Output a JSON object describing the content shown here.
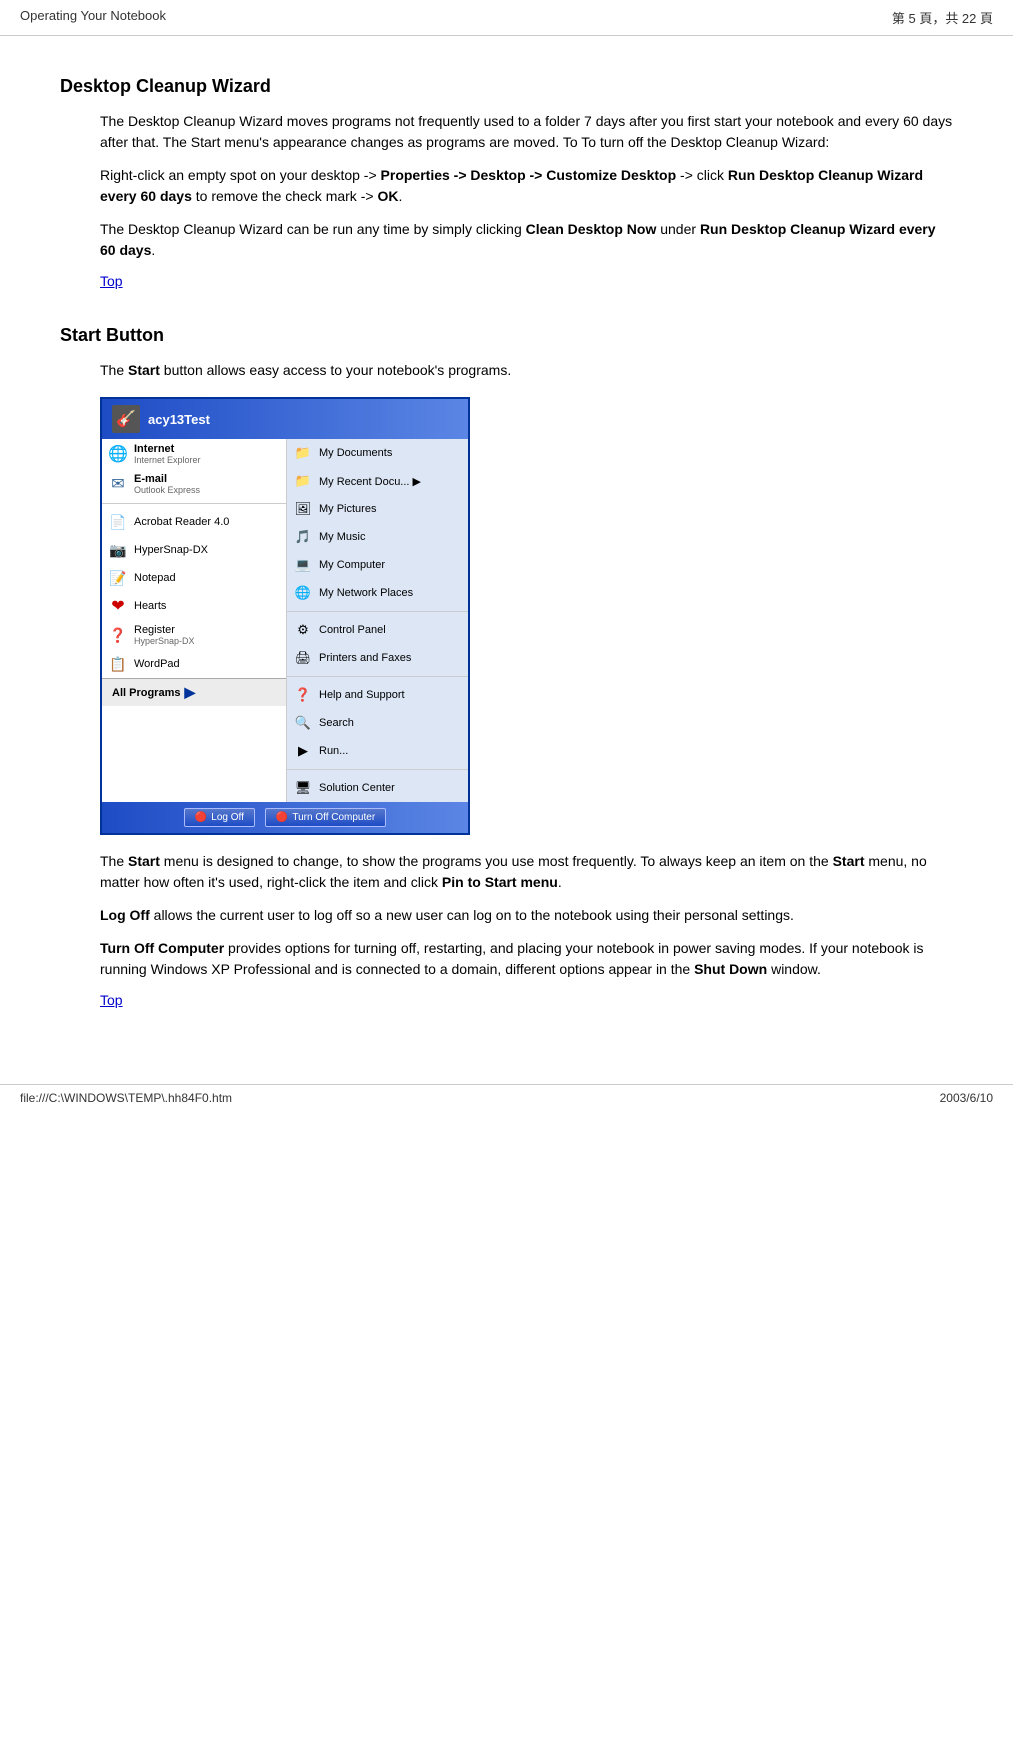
{
  "header": {
    "title": "Operating Your Notebook",
    "page_info": "第 5 頁，共 22 頁"
  },
  "footer": {
    "file_path": "file:///C:\\WINDOWS\\TEMP\\.hh84F0.htm",
    "date": "2003/6/10"
  },
  "section1": {
    "title": "Desktop Cleanup Wizard",
    "paragraphs": [
      "The Desktop Cleanup Wizard moves programs not frequently used to a folder 7 days after you first start your notebook and every 60 days after that. The Start menu's appearance changes as programs are moved. To To turn off the Desktop Cleanup Wizard:",
      "Right-click an empty spot on your desktop -> Properties -> Desktop -> Customize Desktop -> click Run Desktop Cleanup Wizard every 60 days to remove the check mark -> OK.",
      "The Desktop Cleanup Wizard can be run any time by simply clicking Clean Desktop Now under Run Desktop Cleanup Wizard every 60 days."
    ],
    "bold_parts": {
      "p2_b1": "Properties -&gt; Desktop -&gt;",
      "p2_b2": "Customize Desktop",
      "p2_b3": "Run Desktop Cleanup Wizard every 60 days",
      "p2_b4": "OK",
      "p3_b1": "Clean Desktop Now",
      "p3_b2": "Run Desktop Cleanup Wizard every 60 days"
    },
    "top_link": "Top"
  },
  "section2": {
    "title": "Start Button",
    "intro": "The Start button allows easy access to your notebook's programs.",
    "menu_title_user": "acy13Test",
    "left_items": [
      {
        "icon": "🌐",
        "main": "Internet",
        "sub": "Internet Explorer"
      },
      {
        "icon": "✉",
        "main": "E-mail",
        "sub": "Outlook Express"
      },
      {
        "icon": "📄",
        "main": "Acrobat Reader 4.0",
        "sub": ""
      },
      {
        "icon": "📷",
        "main": "HyperSnap-DX",
        "sub": ""
      },
      {
        "icon": "📝",
        "main": "Notepad",
        "sub": ""
      },
      {
        "icon": "❤",
        "main": "Hearts",
        "sub": ""
      },
      {
        "icon": "❓",
        "main": "Register HyperSnap-DX",
        "sub": ""
      },
      {
        "icon": "📋",
        "main": "WordPad",
        "sub": ""
      }
    ],
    "right_items": [
      {
        "icon": "📁",
        "main": "My Documents"
      },
      {
        "icon": "📁",
        "main": "My Recent Docu... ▶"
      },
      {
        "icon": "🖼",
        "main": "My Pictures"
      },
      {
        "icon": "🎵",
        "main": "My Music"
      },
      {
        "icon": "💻",
        "main": "My Computer"
      },
      {
        "icon": "🌐",
        "main": "My Network Places"
      },
      {
        "icon": "⚙",
        "main": "Control Panel"
      },
      {
        "icon": "🖨",
        "main": "Printers and Faxes"
      },
      {
        "icon": "❓",
        "main": "Help and Support"
      },
      {
        "icon": "🔍",
        "main": "Search"
      },
      {
        "icon": "▶",
        "main": "Run..."
      },
      {
        "icon": "🖥",
        "main": "Solution Center"
      }
    ],
    "all_programs": "All Programs",
    "bottom_buttons": [
      "Log Off",
      "Turn Off Computer"
    ],
    "paragraphs_after": [
      {
        "text": "The Start menu is designed to change, to show the programs you use most frequently. To always keep an item on the Start menu, no matter how often it's used, right-click the item and click Pin to Start menu.",
        "bold": [
          "Start",
          "Start",
          "Pin to Start menu"
        ]
      },
      {
        "text": "Log Off allows the current user to log off so a new user can log on to the notebook using their personal settings.",
        "bold": [
          "Log Off"
        ]
      },
      {
        "text": "Turn Off Computer provides options for turning off, restarting, and placing your notebook in power saving modes. If your notebook is running Windows XP Professional and is connected to a domain, different options appear in the Shut Down window.",
        "bold": [
          "Turn Off Computer",
          "Shut Down"
        ]
      }
    ],
    "top_link": "Top"
  }
}
